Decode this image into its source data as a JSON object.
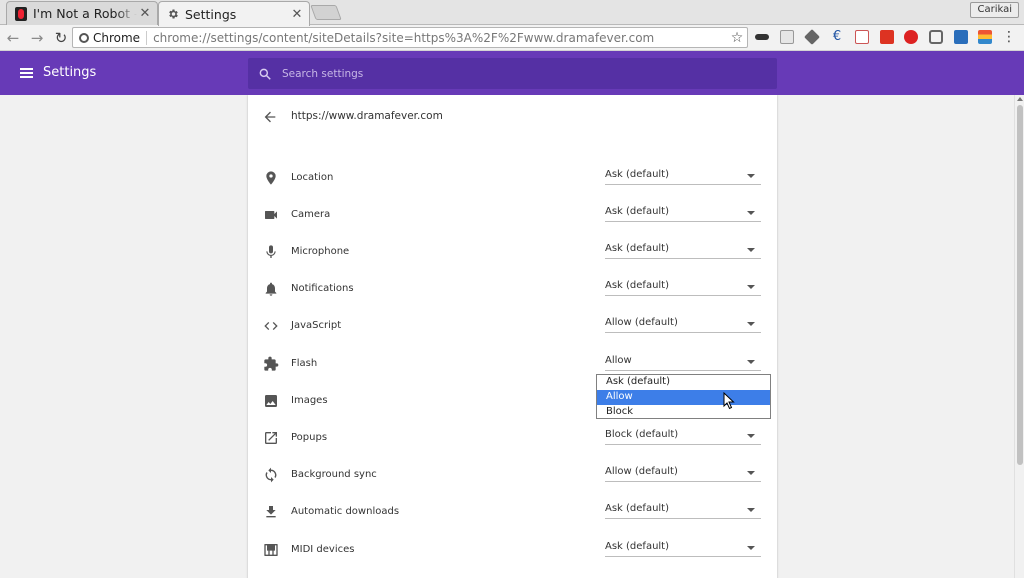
{
  "browser": {
    "tabs": [
      {
        "title": "I'm Not a Robot - - V",
        "active": false
      },
      {
        "title": "Settings",
        "active": true
      }
    ],
    "profile_name": "Carikai",
    "omnibox": {
      "chip": "Chrome",
      "url": "chrome://settings/content/siteDetails?site=https%3A%2F%2Fwww.dramafever.com"
    }
  },
  "header": {
    "title": "Settings",
    "search_placeholder": "Search settings"
  },
  "site": {
    "url": "https://www.dramafever.com"
  },
  "permissions": [
    {
      "label": "Location",
      "value": "Ask (default)",
      "icon": "location-pin-icon"
    },
    {
      "label": "Camera",
      "value": "Ask (default)",
      "icon": "camera-icon"
    },
    {
      "label": "Microphone",
      "value": "Ask (default)",
      "icon": "microphone-icon"
    },
    {
      "label": "Notifications",
      "value": "Ask (default)",
      "icon": "bell-icon"
    },
    {
      "label": "JavaScript",
      "value": "Allow (default)",
      "icon": "code-icon"
    },
    {
      "label": "Flash",
      "value": "Allow",
      "icon": "puzzle-icon"
    },
    {
      "label": "Images",
      "value": "",
      "icon": "image-icon"
    },
    {
      "label": "Popups",
      "value": "Block (default)",
      "icon": "popup-icon"
    },
    {
      "label": "Background sync",
      "value": "Allow (default)",
      "icon": "sync-icon"
    },
    {
      "label": "Automatic downloads",
      "value": "Ask (default)",
      "icon": "download-icon"
    },
    {
      "label": "MIDI devices",
      "value": "Ask (default)",
      "icon": "piano-icon"
    }
  ],
  "dropdown": {
    "options": [
      "Ask (default)",
      "Allow",
      "Block"
    ],
    "selected": "Allow"
  },
  "colors": {
    "header": "#673ab7",
    "search": "#5530a4",
    "selection": "#3d7ee8"
  }
}
